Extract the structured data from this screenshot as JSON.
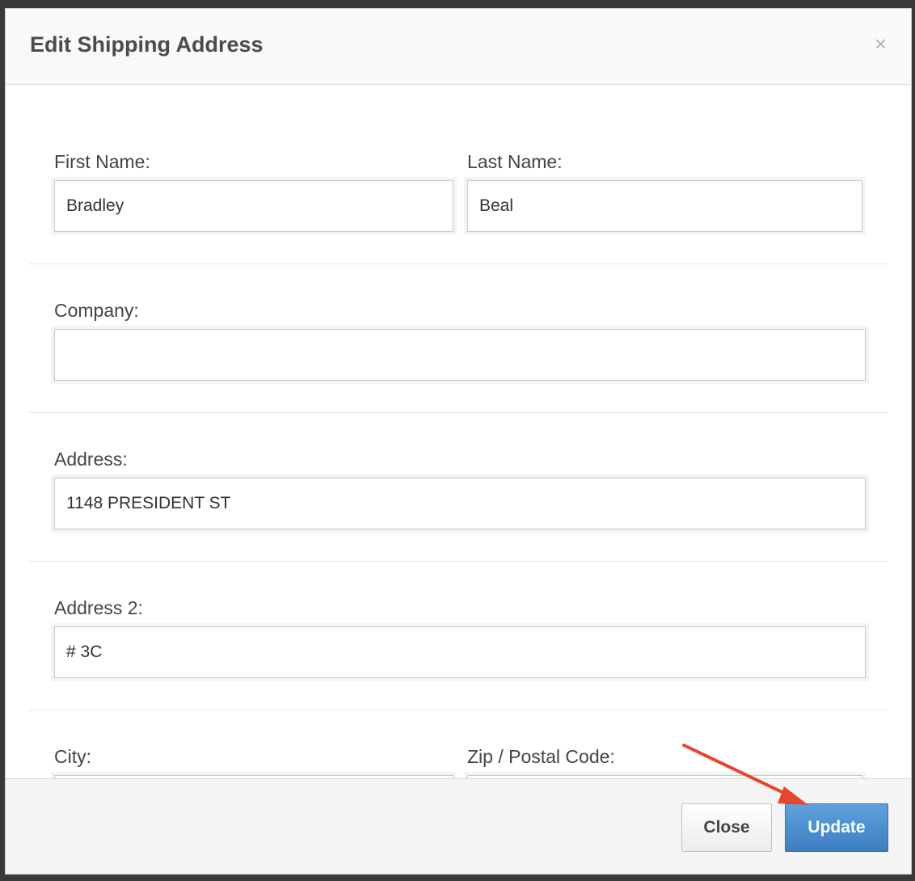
{
  "modal": {
    "title": "Edit Shipping Address",
    "close_icon": "×"
  },
  "fields": {
    "first_name": {
      "label": "First Name:",
      "value": "Bradley"
    },
    "last_name": {
      "label": "Last Name:",
      "value": "Beal"
    },
    "company": {
      "label": "Company:",
      "value": ""
    },
    "address": {
      "label": "Address:",
      "value": "1148 PRESIDENT ST"
    },
    "address2": {
      "label": "Address 2:",
      "value": "# 3C"
    },
    "city": {
      "label": "City:",
      "value": ""
    },
    "zip": {
      "label": "Zip / Postal Code:",
      "value": ""
    }
  },
  "footer": {
    "close_label": "Close",
    "update_label": "Update"
  },
  "colors": {
    "annotation_arrow": "#e8452c",
    "primary_button": "#4a8cd0"
  },
  "icons": {
    "close": "close-icon",
    "annotation": "arrow-annotation-icon"
  }
}
